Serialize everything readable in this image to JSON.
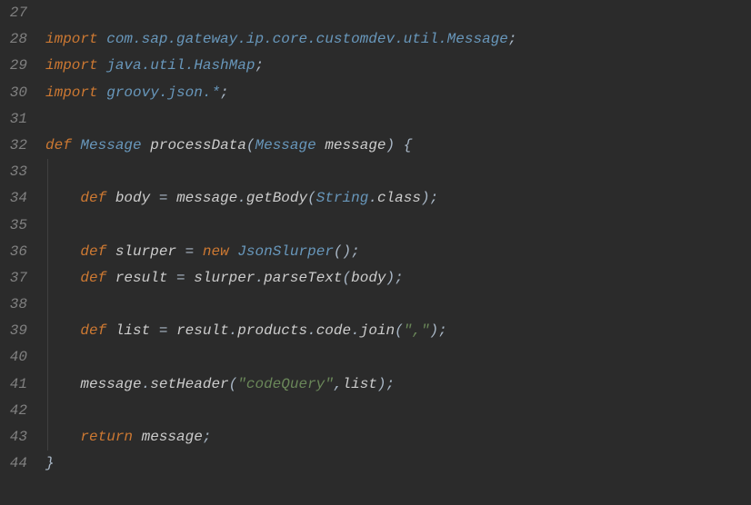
{
  "editor": {
    "startLine": 27,
    "lines": {
      "27": {
        "tokens": [
          {
            "t": "import",
            "c": "kw"
          },
          {
            "t": " ",
            "c": "plain"
          },
          {
            "t": "com.sap.gateway.ip.core.customdev.util.Message",
            "c": "type"
          },
          {
            "t": ";",
            "c": "punct"
          }
        ]
      },
      "28": {
        "tokens": [
          {
            "t": "import",
            "c": "kw"
          },
          {
            "t": " ",
            "c": "plain"
          },
          {
            "t": "java.util.HashMap",
            "c": "type"
          },
          {
            "t": ";",
            "c": "punct"
          }
        ]
      },
      "29": {
        "tokens": [
          {
            "t": "import",
            "c": "kw"
          },
          {
            "t": " ",
            "c": "plain"
          },
          {
            "t": "groovy.json.*",
            "c": "type"
          },
          {
            "t": ";",
            "c": "punct"
          }
        ]
      },
      "30": {
        "tokens": []
      },
      "31": {
        "tokens": [
          {
            "t": "def",
            "c": "kw"
          },
          {
            "t": " ",
            "c": "plain"
          },
          {
            "t": "Message",
            "c": "type"
          },
          {
            "t": " ",
            "c": "plain"
          },
          {
            "t": "processData",
            "c": "plain"
          },
          {
            "t": "(",
            "c": "paren"
          },
          {
            "t": "Message",
            "c": "type"
          },
          {
            "t": " ",
            "c": "plain"
          },
          {
            "t": "message",
            "c": "plain"
          },
          {
            "t": ")",
            "c": "paren"
          },
          {
            "t": " ",
            "c": "plain"
          },
          {
            "t": "{",
            "c": "punct"
          }
        ]
      },
      "32": {
        "tokens": [],
        "indent": 1
      },
      "33": {
        "indent": 1,
        "tokens": [
          {
            "t": "    ",
            "c": "plain"
          },
          {
            "t": "def",
            "c": "kw"
          },
          {
            "t": " ",
            "c": "plain"
          },
          {
            "t": "body",
            "c": "plain"
          },
          {
            "t": " ",
            "c": "plain"
          },
          {
            "t": "=",
            "c": "op"
          },
          {
            "t": " ",
            "c": "plain"
          },
          {
            "t": "message",
            "c": "plain"
          },
          {
            "t": ".",
            "c": "punct"
          },
          {
            "t": "getBody",
            "c": "plain"
          },
          {
            "t": "(",
            "c": "paren"
          },
          {
            "t": "String",
            "c": "type"
          },
          {
            "t": ".",
            "c": "punct"
          },
          {
            "t": "class",
            "c": "plain"
          },
          {
            "t": ")",
            "c": "paren"
          },
          {
            "t": ";",
            "c": "punct"
          }
        ]
      },
      "34": {
        "tokens": [],
        "indent": 1
      },
      "35": {
        "indent": 1,
        "tokens": [
          {
            "t": "    ",
            "c": "plain"
          },
          {
            "t": "def",
            "c": "kw"
          },
          {
            "t": " ",
            "c": "plain"
          },
          {
            "t": "slurper",
            "c": "plain"
          },
          {
            "t": " ",
            "c": "plain"
          },
          {
            "t": "=",
            "c": "op"
          },
          {
            "t": " ",
            "c": "plain"
          },
          {
            "t": "new",
            "c": "kw"
          },
          {
            "t": " ",
            "c": "plain"
          },
          {
            "t": "JsonSlurper",
            "c": "type"
          },
          {
            "t": "()",
            "c": "paren"
          },
          {
            "t": ";",
            "c": "punct"
          }
        ]
      },
      "36": {
        "indent": 1,
        "tokens": [
          {
            "t": "    ",
            "c": "plain"
          },
          {
            "t": "def",
            "c": "kw"
          },
          {
            "t": " ",
            "c": "plain"
          },
          {
            "t": "result",
            "c": "plain"
          },
          {
            "t": " ",
            "c": "plain"
          },
          {
            "t": "=",
            "c": "op"
          },
          {
            "t": " ",
            "c": "plain"
          },
          {
            "t": "slurper",
            "c": "plain"
          },
          {
            "t": ".",
            "c": "punct"
          },
          {
            "t": "parseText",
            "c": "plain"
          },
          {
            "t": "(",
            "c": "paren"
          },
          {
            "t": "body",
            "c": "plain"
          },
          {
            "t": ")",
            "c": "paren"
          },
          {
            "t": ";",
            "c": "punct"
          }
        ]
      },
      "37": {
        "tokens": [],
        "indent": 1
      },
      "38": {
        "indent": 1,
        "tokens": [
          {
            "t": "    ",
            "c": "plain"
          },
          {
            "t": "def",
            "c": "kw"
          },
          {
            "t": " ",
            "c": "plain"
          },
          {
            "t": "list",
            "c": "plain"
          },
          {
            "t": " ",
            "c": "plain"
          },
          {
            "t": "=",
            "c": "op"
          },
          {
            "t": " ",
            "c": "plain"
          },
          {
            "t": "result",
            "c": "plain"
          },
          {
            "t": ".",
            "c": "punct"
          },
          {
            "t": "products",
            "c": "plain"
          },
          {
            "t": ".",
            "c": "punct"
          },
          {
            "t": "code",
            "c": "plain"
          },
          {
            "t": ".",
            "c": "punct"
          },
          {
            "t": "join",
            "c": "plain"
          },
          {
            "t": "(",
            "c": "paren"
          },
          {
            "t": "\",\"",
            "c": "str"
          },
          {
            "t": ")",
            "c": "paren"
          },
          {
            "t": ";",
            "c": "punct"
          }
        ]
      },
      "39": {
        "tokens": [],
        "indent": 1
      },
      "40": {
        "indent": 1,
        "tokens": [
          {
            "t": "    ",
            "c": "plain"
          },
          {
            "t": "message",
            "c": "plain"
          },
          {
            "t": ".",
            "c": "punct"
          },
          {
            "t": "setHeader",
            "c": "plain"
          },
          {
            "t": "(",
            "c": "paren"
          },
          {
            "t": "\"codeQuery\"",
            "c": "str"
          },
          {
            "t": ",",
            "c": "punct"
          },
          {
            "t": "list",
            "c": "plain"
          },
          {
            "t": ")",
            "c": "paren"
          },
          {
            "t": ";",
            "c": "punct"
          }
        ]
      },
      "41": {
        "tokens": [],
        "indent": 1
      },
      "42": {
        "indent": 1,
        "tokens": [
          {
            "t": "    ",
            "c": "plain"
          },
          {
            "t": "return",
            "c": "kw"
          },
          {
            "t": " ",
            "c": "plain"
          },
          {
            "t": "message",
            "c": "plain"
          },
          {
            "t": ";",
            "c": "punct"
          }
        ]
      },
      "43": {
        "tokens": [
          {
            "t": "}",
            "c": "punct"
          }
        ]
      },
      "44": {
        "tokens": []
      }
    },
    "lineNumbers": [
      "27",
      "28",
      "29",
      "30",
      "31",
      "32",
      "33",
      "34",
      "35",
      "36",
      "37",
      "38",
      "39",
      "40",
      "41",
      "42",
      "43",
      "44"
    ]
  }
}
